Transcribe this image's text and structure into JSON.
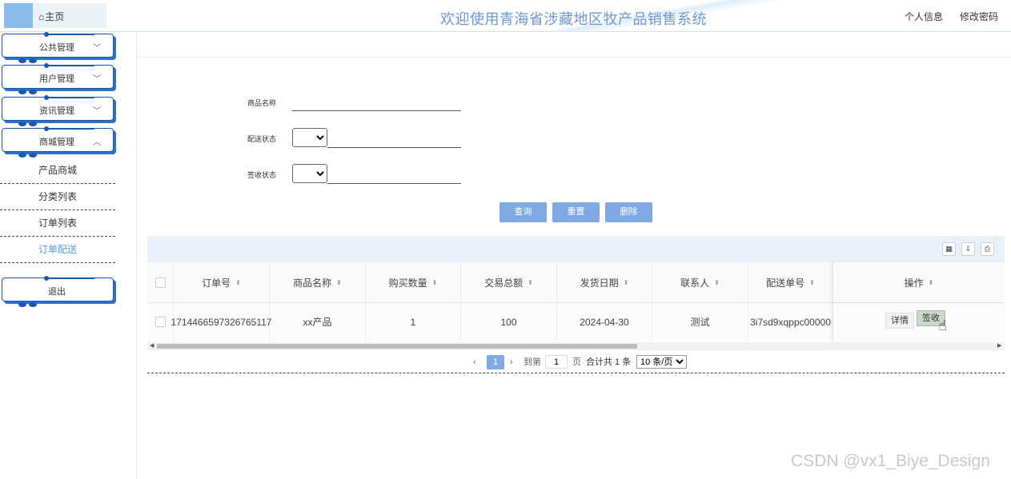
{
  "header": {
    "home": "主页",
    "title": "欢迎使用青海省涉藏地区牧产品销售系统",
    "profile": "个人信息",
    "change_password": "修改密码"
  },
  "sidebar": {
    "menus": [
      {
        "label": "公共管理",
        "chevron": "﹀"
      },
      {
        "label": "用户管理",
        "chevron": "﹀"
      },
      {
        "label": "资讯管理",
        "chevron": "﹀"
      },
      {
        "label": "商城管理",
        "chevron": "︿"
      }
    ],
    "sub_items": [
      "产品商城",
      "分类列表",
      "订单列表",
      "订单配送"
    ],
    "logout": "退出"
  },
  "form": {
    "product_name_label": "商品名称",
    "product_name_value": "",
    "delivery_status_label": "配送状态",
    "delivery_status_value": "",
    "receipt_status_label": "签收状态",
    "receipt_status_value": ""
  },
  "buttons": {
    "query": "查询",
    "reset": "重置",
    "delete": "删除"
  },
  "table": {
    "columns": [
      "订单号",
      "商品名称",
      "购买数量",
      "交易总额",
      "发货日期",
      "联系人",
      "配送单号",
      "操作"
    ],
    "rows": [
      {
        "order_no": "1714466597326765117",
        "product": "xx产品",
        "qty": "1",
        "total": "100",
        "ship_date": "2024-04-30",
        "contact": "测试",
        "delivery_no": "3i7sd9xqppc00000",
        "detail": "详情",
        "sign": "签收"
      }
    ]
  },
  "pager": {
    "current": "1",
    "goto_label": "到第",
    "goto_value": "1",
    "page_unit": "页",
    "total": "合计共 1 条",
    "page_size": "10 条/页"
  },
  "watermark": "CSDN @vx1_Biye_Design"
}
